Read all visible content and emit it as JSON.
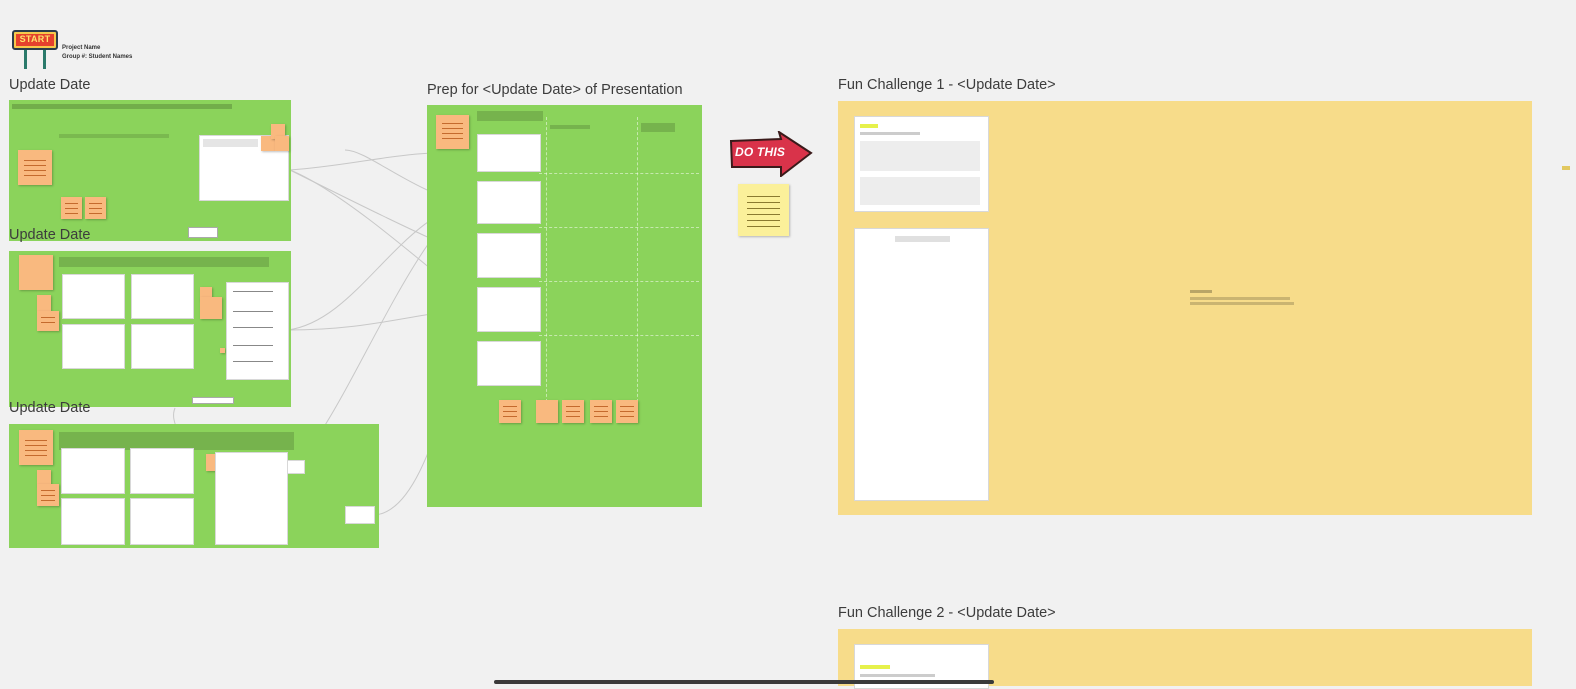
{
  "header": {
    "start_sign": "START",
    "project_name": "Project Name",
    "group_label": "Group #: Student Names"
  },
  "frames": {
    "update1_title": "Update Date",
    "update2_title": "Update Date",
    "update3_title": "Update Date",
    "prep_title": "Prep for <Update Date> of Presentation",
    "fun1_title": "Fun Challenge 1 - <Update Date>",
    "fun2_title": "Fun Challenge 2 - <Update Date>"
  },
  "do_this": {
    "label": "DO THIS"
  },
  "colors": {
    "canvas": "#f1f1f1",
    "green_frame": "#8bd35b",
    "yellow_frame": "#f7dc8a",
    "sticky_orange": "#f9b97f",
    "sticky_yellow": "#fbf09a",
    "arrow_red": "#d9334a"
  },
  "icons": [
    "start-sign-icon",
    "do-this-arrow-icon"
  ]
}
